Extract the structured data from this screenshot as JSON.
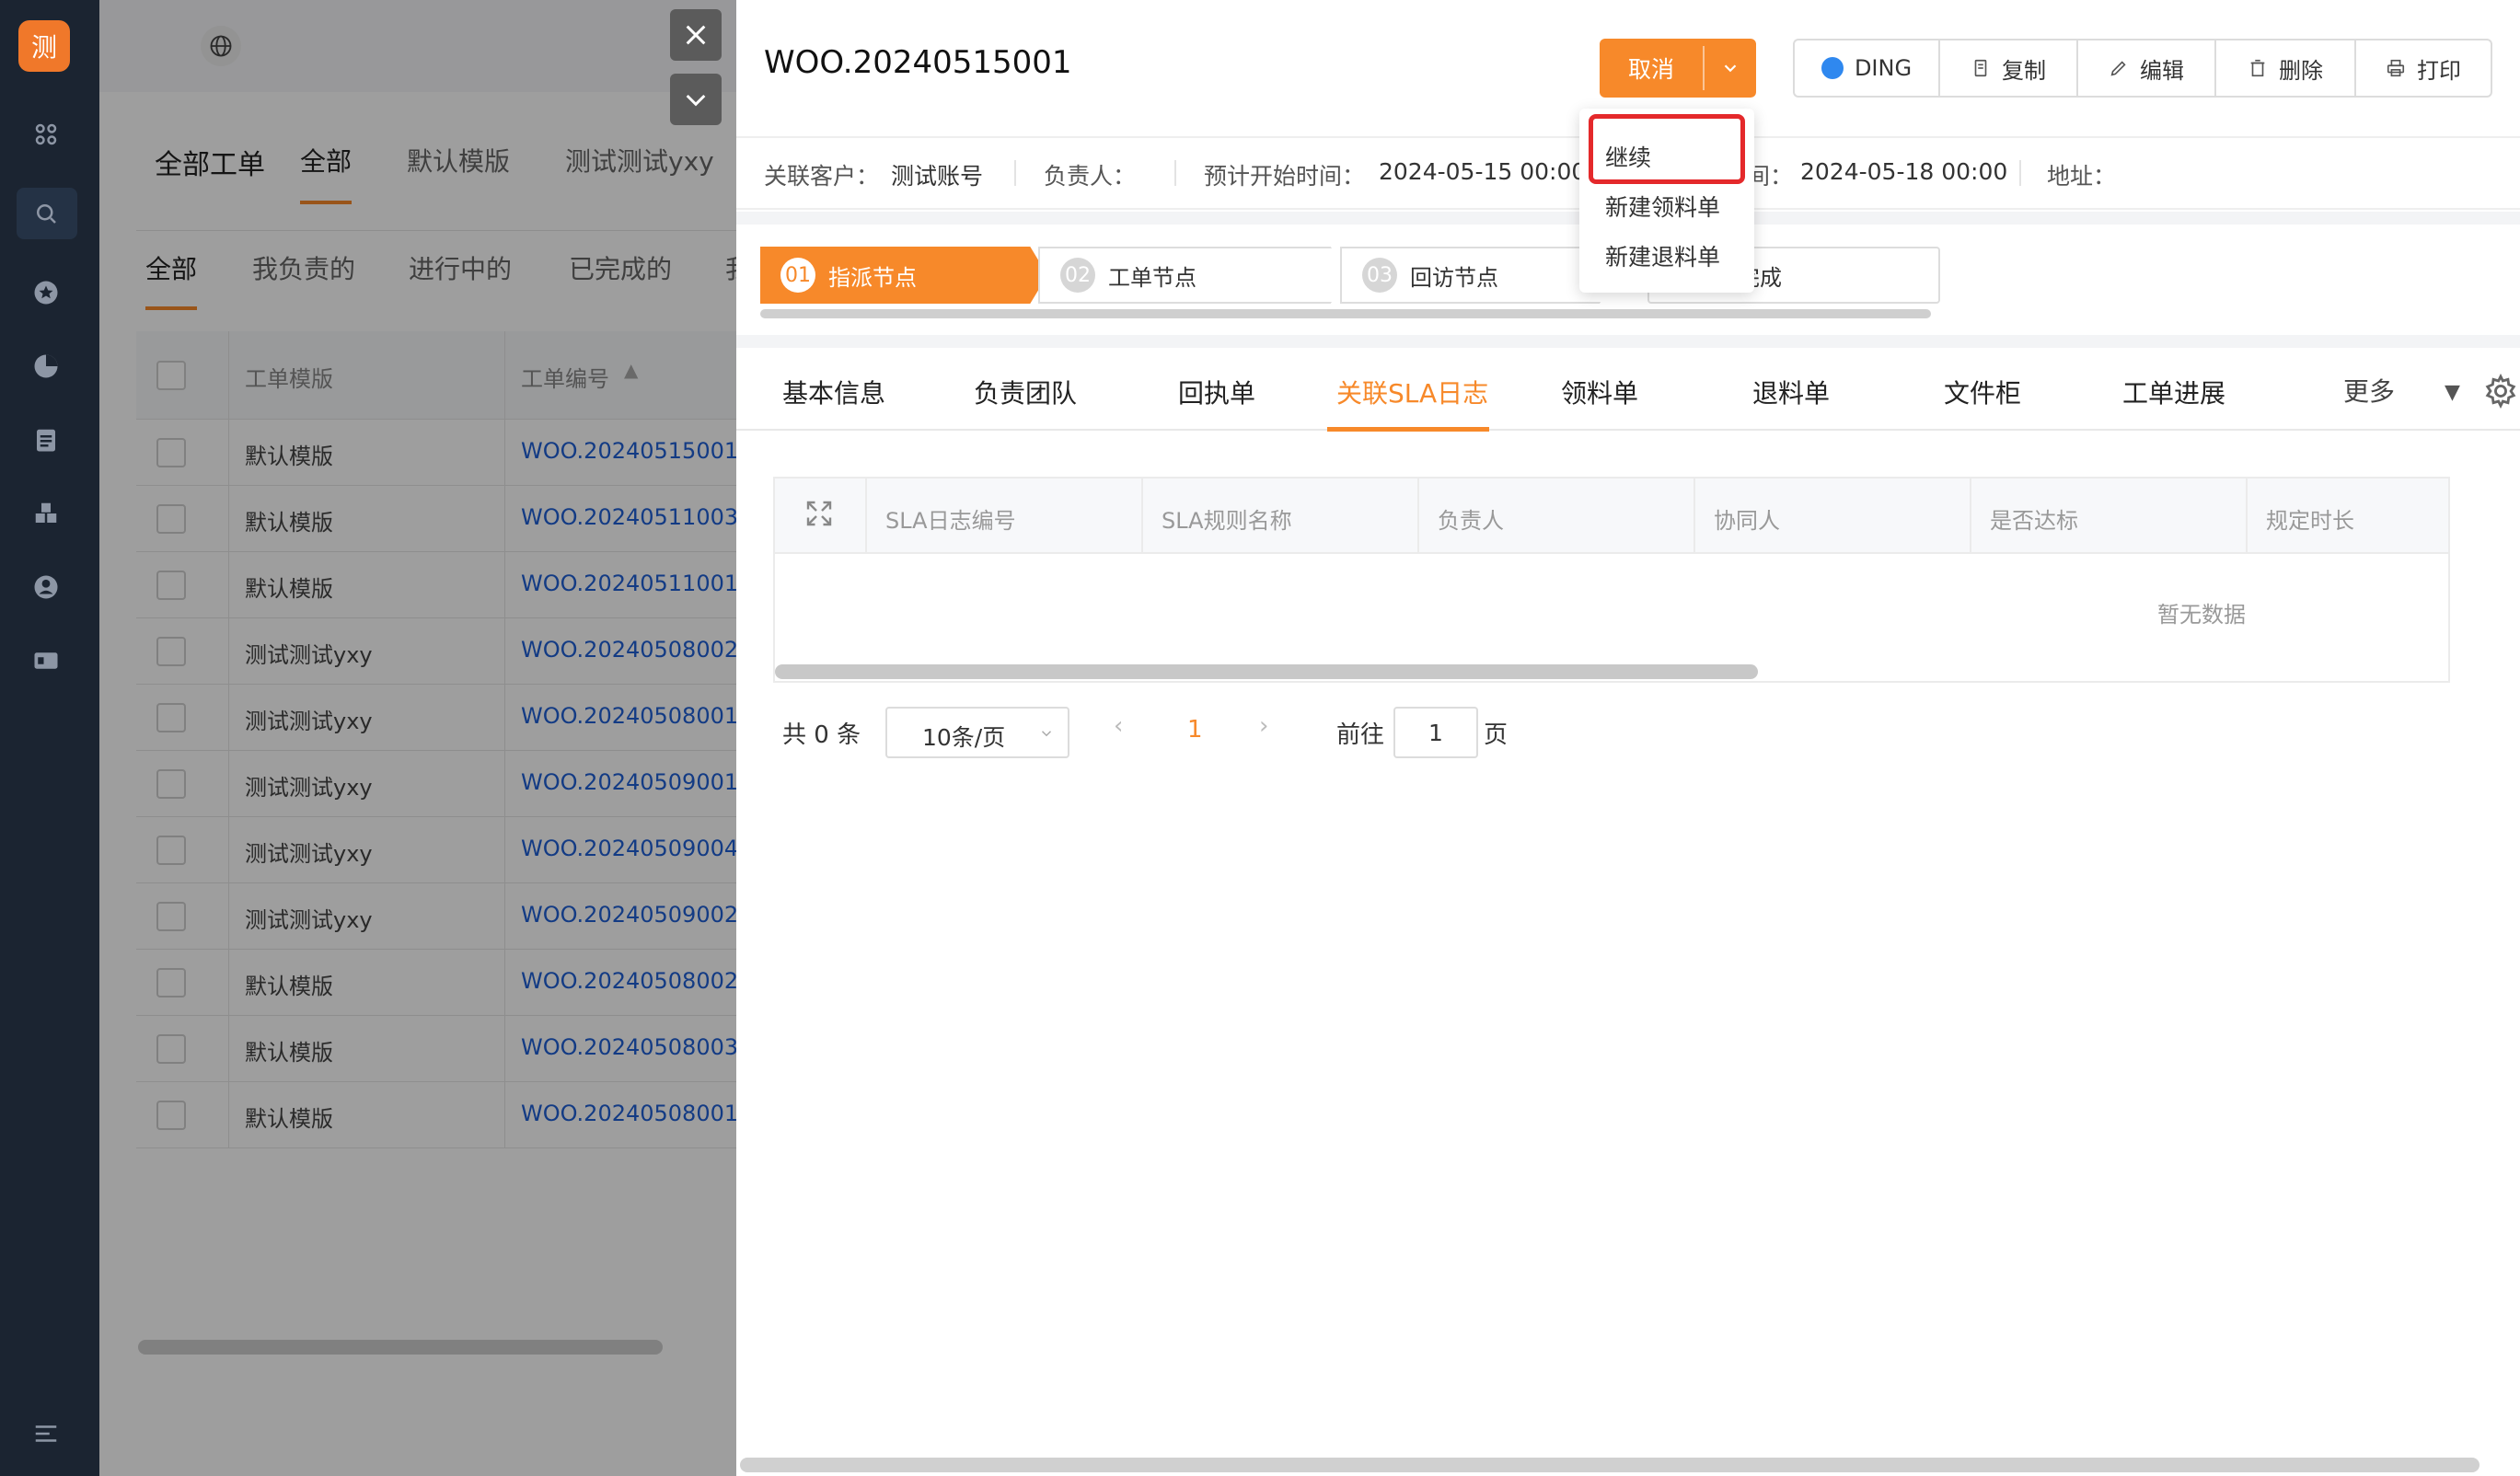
{
  "sidebar": {
    "logo_text": "测",
    "icons": [
      "apps-icon",
      "search-icon",
      "star-icon",
      "pie-chart-icon",
      "clipboard-icon",
      "blocks-icon",
      "user-icon",
      "card-icon",
      "menu-collapse-icon"
    ]
  },
  "bg_list": {
    "top_tabs": [
      "全部工单",
      "全部",
      "默认模版",
      "测试测试yxy"
    ],
    "sub_tabs": [
      "全部",
      "我负责的",
      "进行中的",
      "已完成的",
      "我"
    ],
    "columns": [
      "工单模版",
      "工单编号"
    ],
    "rows": [
      {
        "template": "默认模版",
        "number": "WOO.20240515001"
      },
      {
        "template": "默认模版",
        "number": "WOO.20240511003"
      },
      {
        "template": "默认模版",
        "number": "WOO.20240511001"
      },
      {
        "template": "测试测试yxy",
        "number": "WOO.20240508002"
      },
      {
        "template": "测试测试yxy",
        "number": "WOO.20240508001"
      },
      {
        "template": "测试测试yxy",
        "number": "WOO.20240509001"
      },
      {
        "template": "测试测试yxy",
        "number": "WOO.20240509004"
      },
      {
        "template": "测试测试yxy",
        "number": "WOO.20240509002"
      },
      {
        "template": "默认模版",
        "number": "WOO.20240508002"
      },
      {
        "template": "默认模版",
        "number": "WOO.20240508003"
      },
      {
        "template": "默认模版",
        "number": "WOO.20240508001"
      }
    ]
  },
  "drawer": {
    "title": "WOO.20240515001",
    "primary_button": "取消",
    "toolbar": [
      "DING",
      "复制",
      "编辑",
      "删除",
      "打印"
    ],
    "dropdown": [
      "继续",
      "新建领料单",
      "新建退料单"
    ],
    "info": {
      "customer_label": "关联客户：",
      "customer_value": "测试账号",
      "owner_label": "负责人：",
      "start_label": "预计开始时间：",
      "start_value": "2024-05-15 00:00",
      "end_label_tail": "间：",
      "end_value": "2024-05-18 00:00",
      "address_label": "地址："
    },
    "steps": [
      {
        "num": "01",
        "label": "指派节点"
      },
      {
        "num": "02",
        "label": "工单节点"
      },
      {
        "num": "03",
        "label": "回访节点"
      },
      {
        "num": "",
        "label": "完成"
      }
    ],
    "tabs": [
      "基本信息",
      "负责团队",
      "回执单",
      "关联SLA日志",
      "领料单",
      "退料单",
      "文件柜",
      "工单进展",
      "更多"
    ],
    "active_tab": "关联SLA日志",
    "table_headers": [
      "SLA日志编号",
      "SLA规则名称",
      "负责人",
      "协同人",
      "是否达标",
      "规定时长"
    ],
    "empty_text": "暂无数据",
    "pagination": {
      "total": "共 0 条",
      "page_size": "10条/页",
      "current_page": "1",
      "goto_label": "前往",
      "goto_value": "1",
      "page_suffix": "页"
    },
    "accent_color": "#f7892a"
  }
}
